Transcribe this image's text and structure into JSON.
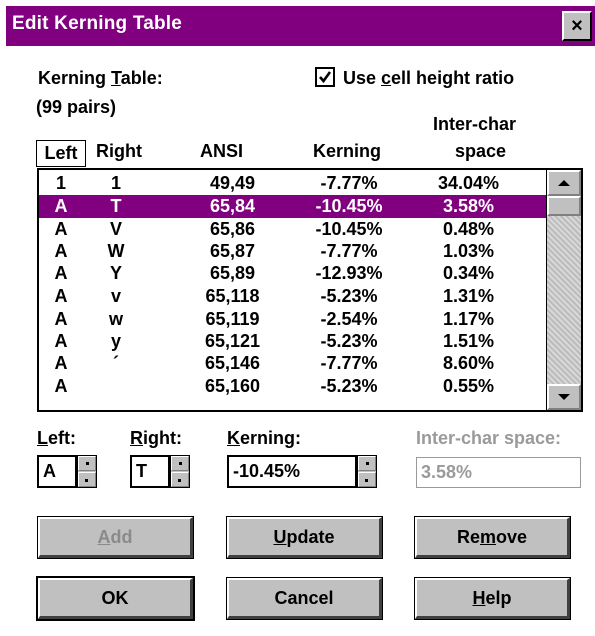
{
  "dialog": {
    "title": "Edit Kerning Table",
    "close_label": "×"
  },
  "labels": {
    "kerning_table": "Kerning Table:",
    "pairs": "(99 pairs)",
    "use_cell_height_ratio": "Use cell height ratio",
    "use_cell_height_checked": true
  },
  "table": {
    "columns": [
      "Left",
      "Right",
      "ANSI",
      "Kerning",
      "Inter-char",
      "space"
    ],
    "rows": [
      {
        "left": "1",
        "right": "1",
        "ansi": "49,49",
        "kerning": "-7.77%",
        "inter": "34.04%"
      },
      {
        "left": "A",
        "right": "T",
        "ansi": "65,84",
        "kerning": "-10.45%",
        "inter": "3.58%"
      },
      {
        "left": "A",
        "right": "V",
        "ansi": "65,86",
        "kerning": "-10.45%",
        "inter": "0.48%"
      },
      {
        "left": "A",
        "right": "W",
        "ansi": "65,87",
        "kerning": "-7.77%",
        "inter": "1.03%"
      },
      {
        "left": "A",
        "right": "Y",
        "ansi": "65,89",
        "kerning": "-12.93%",
        "inter": "0.34%"
      },
      {
        "left": "A",
        "right": "v",
        "ansi": "65,118",
        "kerning": "-5.23%",
        "inter": "1.31%"
      },
      {
        "left": "A",
        "right": "w",
        "ansi": "65,119",
        "kerning": "-2.54%",
        "inter": "1.17%"
      },
      {
        "left": "A",
        "right": "y",
        "ansi": "65,121",
        "kerning": "-5.23%",
        "inter": "1.51%"
      },
      {
        "left": "A",
        "right": "´",
        "ansi": "65,146",
        "kerning": "-7.77%",
        "inter": "8.60%"
      },
      {
        "left": "A",
        "right": "",
        "ansi": "65,160",
        "kerning": "-5.23%",
        "inter": "0.55%"
      }
    ],
    "selected_row": 1
  },
  "editor": {
    "left_label": "Left:",
    "right_label": "Right:",
    "kerning_label": "Kerning:",
    "inter_label": "Inter-char space:",
    "left_value": "A",
    "right_value": "T",
    "kerning_value": "-10.45%",
    "inter_value": "3.58%"
  },
  "buttons": {
    "add": "Add",
    "update": "Update",
    "remove": "Remove",
    "ok": "OK",
    "cancel": "Cancel",
    "help": "Help"
  },
  "colors": {
    "title_bar": "#800080",
    "selection": "#800080",
    "face": "#c0c0c0"
  }
}
